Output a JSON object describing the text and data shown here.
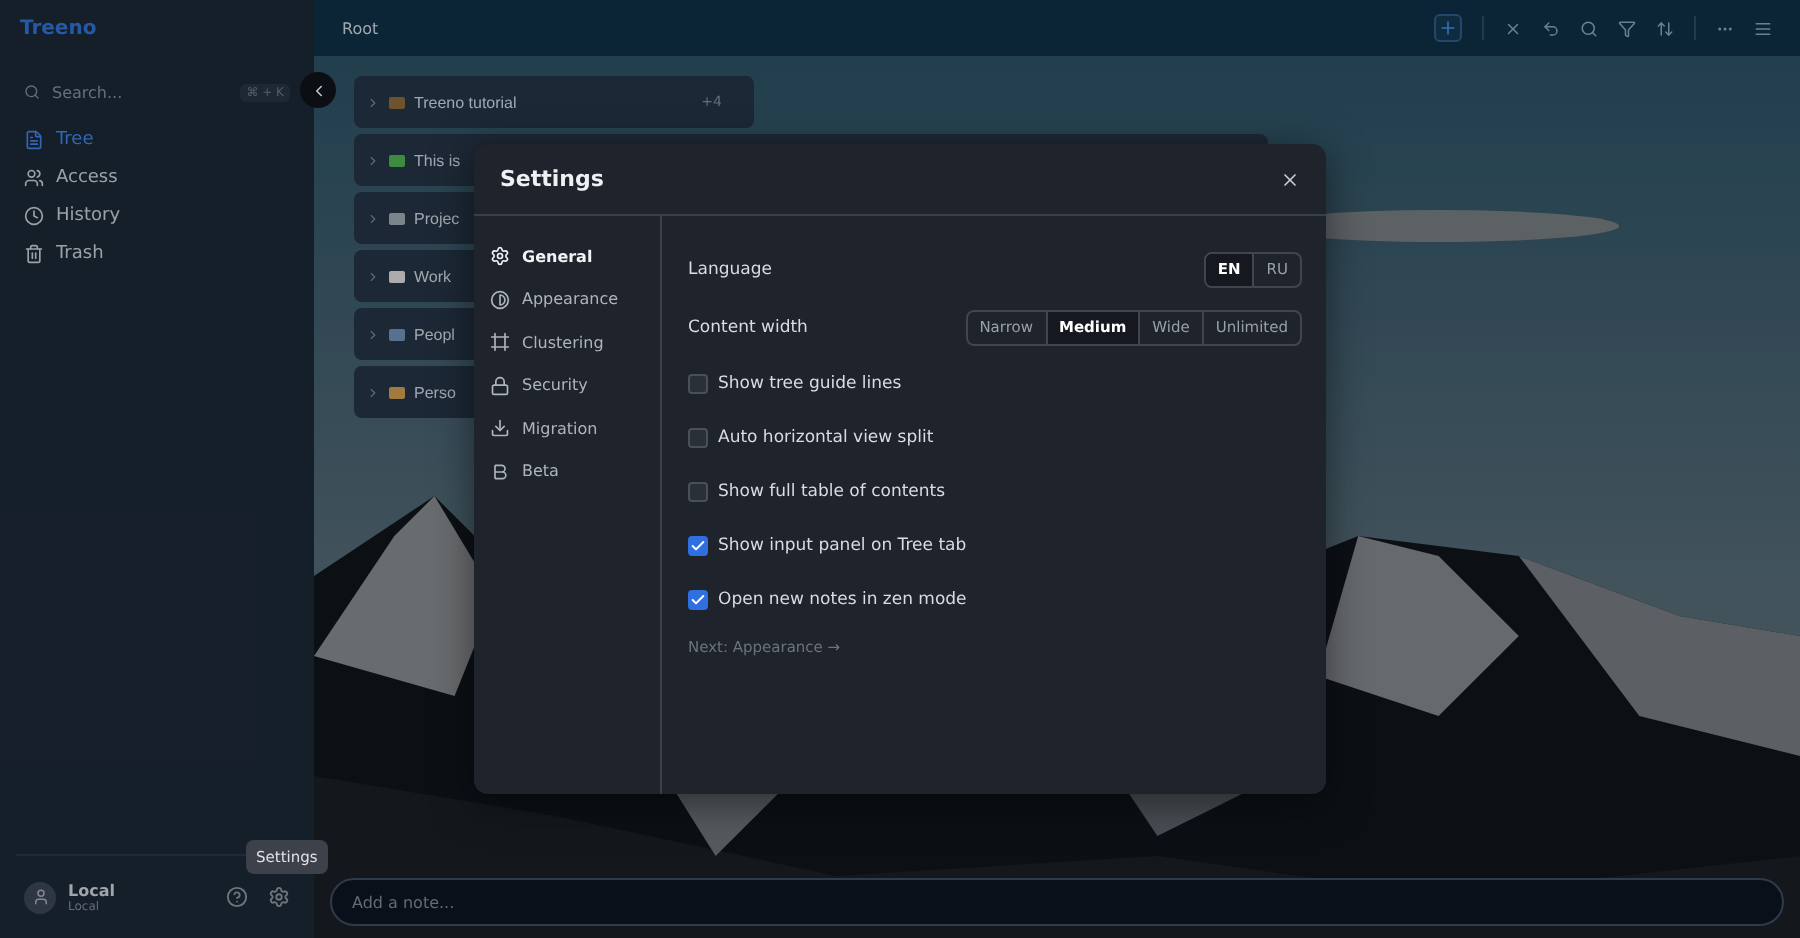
{
  "app": {
    "logo": "Treeno",
    "breadcrumb": "Root"
  },
  "sidebar": {
    "search": {
      "placeholder": "Search...",
      "shortcut": "⌘ + K"
    },
    "items": [
      {
        "label": "Tree",
        "selected": true
      },
      {
        "label": "Access",
        "selected": false
      },
      {
        "label": "History",
        "selected": false
      },
      {
        "label": "Trash",
        "selected": false
      }
    ],
    "user": {
      "name": "Local",
      "subtitle": "Local"
    },
    "tooltip": "Settings"
  },
  "tree": {
    "items": [
      {
        "label": "Treeno tutorial",
        "count": "+4"
      },
      {
        "label": "This is"
      },
      {
        "label": "Projec"
      },
      {
        "label": "Work"
      },
      {
        "label": "Peopl"
      },
      {
        "label": "Perso"
      }
    ]
  },
  "settings": {
    "title": "Settings",
    "nav": [
      {
        "label": "General",
        "selected": true
      },
      {
        "label": "Appearance",
        "selected": false
      },
      {
        "label": "Clustering",
        "selected": false
      },
      {
        "label": "Security",
        "selected": false
      },
      {
        "label": "Migration",
        "selected": false
      },
      {
        "label": "Beta",
        "selected": false
      }
    ],
    "choices": [
      {
        "label": "Language",
        "options": [
          {
            "label": "EN",
            "selected": true
          },
          {
            "label": "RU",
            "selected": false
          }
        ]
      },
      {
        "label": "Content width",
        "options": [
          {
            "label": "Narrow",
            "selected": false
          },
          {
            "label": "Medium",
            "selected": true
          },
          {
            "label": "Wide",
            "selected": false
          },
          {
            "label": "Unlimited",
            "selected": false
          }
        ]
      }
    ],
    "toggles": [
      {
        "label": "Show tree guide lines",
        "checked": false
      },
      {
        "label": "Auto horizontal view split",
        "checked": false
      },
      {
        "label": "Show full table of contents",
        "checked": false
      },
      {
        "label": "Show input panel on Tree tab",
        "checked": true
      },
      {
        "label": "Open new notes in zen mode",
        "checked": true
      }
    ],
    "next_link": "Next: Appearance →"
  },
  "note_input": {
    "placeholder": "Add a note..."
  }
}
